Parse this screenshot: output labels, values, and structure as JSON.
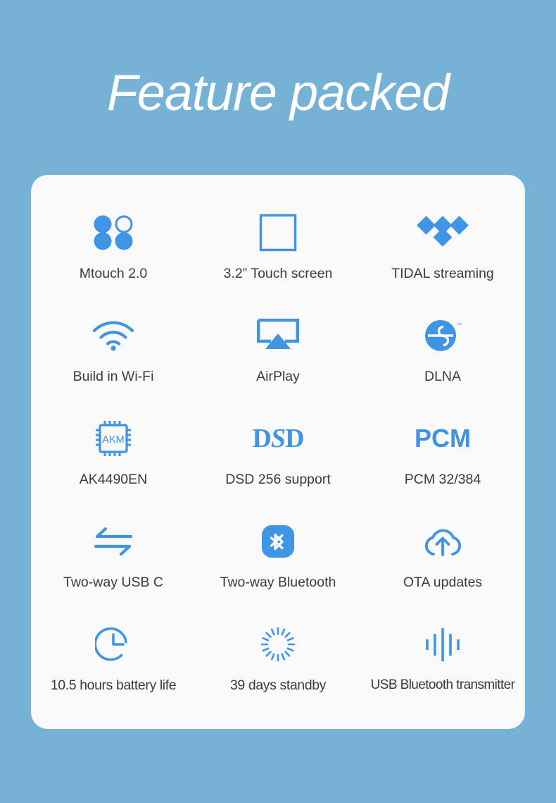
{
  "colors": {
    "background": "#76b2d6",
    "card": "#f9f9f9",
    "accent": "#3f94e3",
    "label_text": "#3b3b3b",
    "title_text": "#ffffff"
  },
  "header": {
    "title": "Feature packed"
  },
  "features": [
    {
      "icon": "mtouch-four-dots-icon",
      "label": "Mtouch 2.0"
    },
    {
      "icon": "touch-screen-square-icon",
      "label": "3.2” Touch screen"
    },
    {
      "icon": "tidal-diamonds-icon",
      "label": "TIDAL streaming"
    },
    {
      "icon": "wifi-icon",
      "label": "Build in Wi-Fi"
    },
    {
      "icon": "airplay-icon",
      "label": "AirPlay"
    },
    {
      "icon": "dlna-icon",
      "label": "DLNA"
    },
    {
      "icon": "akm-chip-icon",
      "label": "AK4490EN"
    },
    {
      "icon": "dsd-wordmark-icon",
      "label": "DSD 256 support"
    },
    {
      "icon": "pcm-wordmark-icon",
      "label": "PCM 32/384"
    },
    {
      "icon": "two-way-arrows-icon",
      "label": "Two-way USB C"
    },
    {
      "icon": "bluetooth-icon",
      "label": "Two-way Bluetooth"
    },
    {
      "icon": "cloud-upload-icon",
      "label": "OTA updates"
    },
    {
      "icon": "clock-icon",
      "label": "10.5 hours battery life"
    },
    {
      "icon": "standby-spinner-icon",
      "label": "39 days standby"
    },
    {
      "icon": "audio-bars-icon",
      "label": "USB Bluetooth transmitter"
    }
  ],
  "icon_marks": {
    "akm": "AKM",
    "dsd_first": "D",
    "dsd_mid": "S",
    "dsd_last": "D",
    "pcm": "PCM"
  }
}
